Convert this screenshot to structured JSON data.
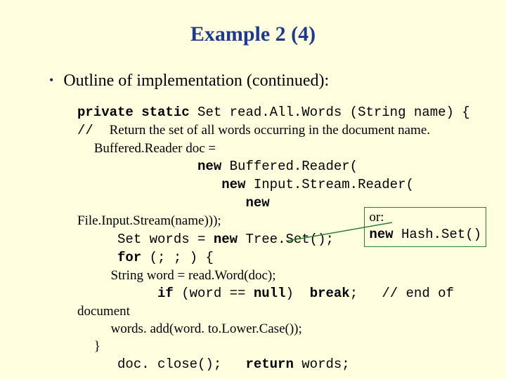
{
  "title": "Example 2 (4)",
  "bullet": "Outline of implementation (continued):",
  "code": {
    "l1a": "private static",
    "l1b": " Set read.All.Words (String name) {",
    "l2a": "//  ",
    "l2b": "Return the set of all words occurring in the document name.",
    "l3": "     Buffered.Reader doc =",
    "l4a": "               ",
    "l4kw": "new",
    "l4b": " Buffered.Reader(",
    "l5a": "                  ",
    "l5kw": "new",
    "l5b": " Input.Stream.Reader(",
    "l6a": "                     ",
    "l6kw": "new",
    "l7": "File.Input.Stream(name)));",
    "l8a": "     Set words = ",
    "l8kw": "new",
    "l8b": " Tree.Set();",
    "l9a": "     ",
    "l9kw": "for",
    "l9b": " (; ; ) {",
    "l10": "          String word = read.Word(doc);",
    "l11a": "          ",
    "l11kw1": "if",
    "l11b": " (word == ",
    "l11kw2": "null",
    "l11c": ")  ",
    "l11kw3": "break",
    "l11d": ";   ",
    "l11e": "// end of",
    "l12": "document",
    "l13": "          words. add(word. to.Lower.Case());",
    "l14": "     }",
    "l15a": "     doc. close();   ",
    "l15kw": "return",
    "l15b": " words;"
  },
  "annot": {
    "line1": "or:",
    "kw": "new",
    "rest": " Hash.Set()"
  }
}
